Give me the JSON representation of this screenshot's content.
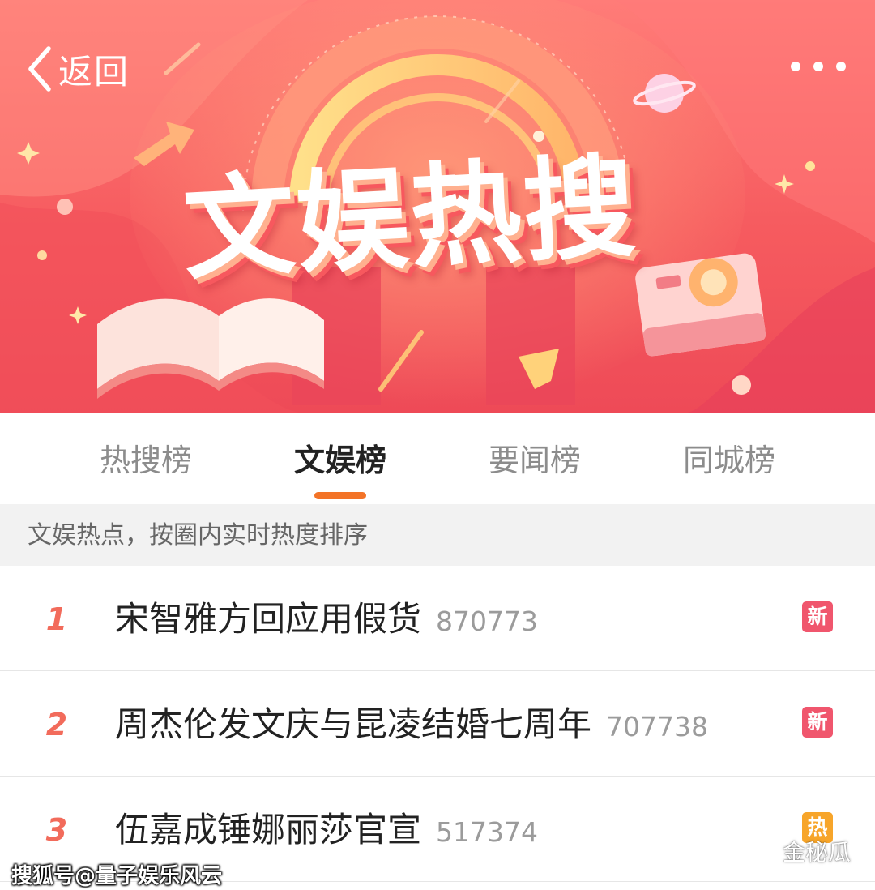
{
  "header": {
    "back_label": "返回",
    "banner_title": "文娱热搜"
  },
  "tabs": [
    {
      "label": "热搜榜",
      "active": false
    },
    {
      "label": "文娱榜",
      "active": true
    },
    {
      "label": "要闻榜",
      "active": false
    },
    {
      "label": "同城榜",
      "active": false
    }
  ],
  "subtitle": "文娱热点，按圈内实时热度排序",
  "items": [
    {
      "rank": "1",
      "title": "宋智雅方回应用假货",
      "count": "870773",
      "badge": "新",
      "badge_color": "#f0566d"
    },
    {
      "rank": "2",
      "title": "周杰伦发文庆与昆凌结婚七周年",
      "count": "707738",
      "badge": "新",
      "badge_color": "#f0566d"
    },
    {
      "rank": "3",
      "title": "伍嘉成锤娜丽莎官宣",
      "count": "517374",
      "badge": "热",
      "badge_color": "#f7a52a"
    }
  ],
  "watermark": {
    "left": "搜狐号@量子娱乐风云",
    "right": "金秘瓜",
    "right_icon": "wechat-icon"
  },
  "colors": {
    "accent": "#f37327",
    "rank": "#f26b5b",
    "banner": "#f65b5f"
  }
}
